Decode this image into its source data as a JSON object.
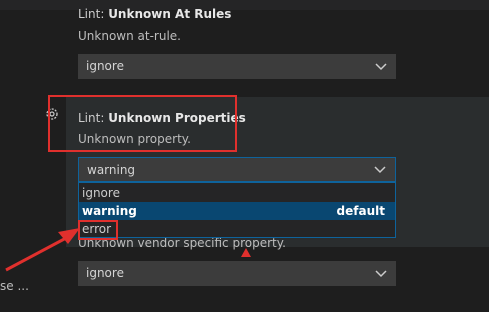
{
  "settings": [
    {
      "prefix": "Lint: ",
      "name": "Unknown At Rules",
      "description": "Unknown at-rule.",
      "value": "ignore"
    },
    {
      "prefix": "Lint: ",
      "name": "Unknown Properties",
      "description": "Unknown property.",
      "value": "warning",
      "options": [
        {
          "label": "ignore"
        },
        {
          "label": "warning",
          "tag": "default"
        },
        {
          "label": "error"
        }
      ]
    },
    {
      "description": "Unknown vendor specific property.",
      "value": "ignore"
    }
  ],
  "left_partial_text": "se ...",
  "icons": {
    "gear": "gear-icon",
    "chevron": "chevron-down-icon"
  },
  "colors": {
    "annotation_red": "#e0302d",
    "focus_blue": "#0e639c",
    "selected_bg": "#094771"
  }
}
